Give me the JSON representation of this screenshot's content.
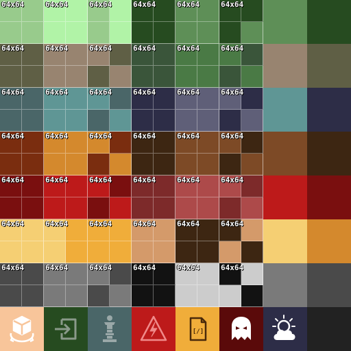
{
  "sheet": {
    "tile_label": "64x64",
    "rows": [
      [
        {
          "q": [
            "#98cb8c",
            "#98cb8c",
            "#98cb8c",
            "#98cb8c"
          ]
        },
        {
          "q": [
            "#b1f3a7",
            "#b1f3a7",
            "#b1f3a7",
            "#b1f3a7"
          ]
        },
        {
          "q": [
            "#98cb8c",
            "#b1f3a7",
            "#98cb8c",
            "#b1f3a7"
          ]
        },
        {
          "q": [
            "#264b20",
            "#264b20",
            "#264b20",
            "#264b20"
          ]
        },
        {
          "q": [
            "#5e8f57",
            "#5e8f57",
            "#5e8f57",
            "#5e8f57"
          ]
        },
        {
          "q": [
            "#264b20",
            "#264b20",
            "#264b20",
            "#5e8f57"
          ]
        },
        {
          "solid": "#5e8f57"
        },
        {
          "solid": "#264b20"
        }
      ],
      [
        {
          "q": [
            "#5f5f45",
            "#5f5f45",
            "#5f5f45",
            "#5f5f45"
          ]
        },
        {
          "q": [
            "#988470",
            "#988470",
            "#988470",
            "#988470"
          ]
        },
        {
          "q": [
            "#988470",
            "#5f5f45",
            "#5f5f45",
            "#988470"
          ]
        },
        {
          "q": [
            "#3a553a",
            "#3a553a",
            "#3a553a",
            "#3a553a"
          ]
        },
        {
          "q": [
            "#4a7a45",
            "#4a7a45",
            "#4a7a45",
            "#4a7a45"
          ]
        },
        {
          "q": [
            "#4a7a45",
            "#3a553a",
            "#3a553a",
            "#4a7a45"
          ]
        },
        {
          "solid": "#988470"
        },
        {
          "solid": "#5f5f45"
        }
      ],
      [
        {
          "q": [
            "#4a6668",
            "#4a6668",
            "#4a6668",
            "#4a6668"
          ]
        },
        {
          "q": [
            "#5f9695",
            "#5f9695",
            "#5f9695",
            "#5f9695"
          ]
        },
        {
          "q": [
            "#5f9695",
            "#4a6668",
            "#4a6668",
            "#5f9695"
          ]
        },
        {
          "q": [
            "#2d2d47",
            "#2d2d47",
            "#2d2d47",
            "#2d2d47"
          ]
        },
        {
          "q": [
            "#5f5f78",
            "#5f5f78",
            "#5f5f78",
            "#5f5f78"
          ]
        },
        {
          "q": [
            "#5f5f78",
            "#2d2d47",
            "#2d2d47",
            "#5f5f78"
          ]
        },
        {
          "solid": "#5f9695"
        },
        {
          "solid": "#2d2d47"
        }
      ],
      [
        {
          "q": [
            "#7a2d0f",
            "#7a2d0f",
            "#7a2d0f",
            "#7a2d0f"
          ]
        },
        {
          "q": [
            "#d4892d",
            "#d4892d",
            "#d4892d",
            "#d4892d"
          ]
        },
        {
          "q": [
            "#d4892d",
            "#7a2d0f",
            "#7a2d0f",
            "#d4892d"
          ]
        },
        {
          "q": [
            "#3d2612",
            "#3d2612",
            "#3d2612",
            "#3d2612"
          ]
        },
        {
          "q": [
            "#7d4a26",
            "#7d4a26",
            "#7d4a26",
            "#7d4a26"
          ]
        },
        {
          "q": [
            "#7d4a26",
            "#3d2612",
            "#3d2612",
            "#7d4a26"
          ]
        },
        {
          "solid": "#7d4a26"
        },
        {
          "solid": "#3d2612"
        }
      ],
      [
        {
          "q": [
            "#7a0f0f",
            "#7a0f0f",
            "#7a0f0f",
            "#7a0f0f"
          ]
        },
        {
          "q": [
            "#bd1a1a",
            "#bd1a1a",
            "#bd1a1a",
            "#bd1a1a"
          ]
        },
        {
          "q": [
            "#bd1a1a",
            "#7a0f0f",
            "#7a0f0f",
            "#bd1a1a"
          ]
        },
        {
          "q": [
            "#7d2a2a",
            "#7d2a2a",
            "#7d2a2a",
            "#7d2a2a"
          ]
        },
        {
          "q": [
            "#ad4a4a",
            "#ad4a4a",
            "#ad4a4a",
            "#ad4a4a"
          ]
        },
        {
          "q": [
            "#ad4a4a",
            "#7d2a2a",
            "#7d2a2a",
            "#ad4a4a"
          ]
        },
        {
          "solid": "#bd1a1a"
        },
        {
          "solid": "#7a0f0f"
        }
      ],
      [
        {
          "q": [
            "#f5cf73",
            "#f5cf73",
            "#f5cf73",
            "#f5cf73"
          ]
        },
        {
          "q": [
            "#f5cf73",
            "#f0ad3a",
            "#f5cf73",
            "#f0ad3a"
          ]
        },
        {
          "q": [
            "#f0ad3a",
            "#f0ad3a",
            "#f0ad3a",
            "#f0ad3a"
          ]
        },
        {
          "q": [
            "#d49a6a",
            "#d49a6a",
            "#d49a6a",
            "#d49a6a"
          ]
        },
        {
          "q": [
            "#3d2612",
            "#3d2612",
            "#3d2612",
            "#3d2612"
          ]
        },
        {
          "q": [
            "#3d2612",
            "#d49a6a",
            "#d49a6a",
            "#3d2612"
          ]
        },
        {
          "solid": "#f5cf73"
        },
        {
          "solid": "#d4892d"
        }
      ],
      [
        {
          "q": [
            "#4a4a4a",
            "#4a4a4a",
            "#4a4a4a",
            "#4a4a4a"
          ]
        },
        {
          "q": [
            "#7a7a7a",
            "#7a7a7a",
            "#7a7a7a",
            "#7a7a7a"
          ]
        },
        {
          "q": [
            "#7a7a7a",
            "#4a4a4a",
            "#4a4a4a",
            "#7a7a7a"
          ]
        },
        {
          "q": [
            "#121212",
            "#121212",
            "#121212",
            "#121212"
          ]
        },
        {
          "q": [
            "#cccccc",
            "#cccccc",
            "#cccccc",
            "#cccccc"
          ]
        },
        {
          "q": [
            "#121212",
            "#cccccc",
            "#cccccc",
            "#121212"
          ]
        },
        {
          "solid": "#7a7a7a"
        },
        {
          "solid": "#4a4a4a"
        }
      ]
    ],
    "icons": [
      {
        "name": "cube-rotate-icon",
        "bg": "#f8c59a"
      },
      {
        "name": "sign-in-icon",
        "bg": "#264b20"
      },
      {
        "name": "statue-icon",
        "bg": "#4a6668"
      },
      {
        "name": "high-voltage-icon",
        "bg": "#bd1a1a"
      },
      {
        "name": "code-file-icon",
        "bg": "#f0ad3a"
      },
      {
        "name": "ghost-icon",
        "bg": "#5a0a0a"
      },
      {
        "name": "partly-cloudy-icon",
        "bg": "#2d2d47"
      },
      {
        "name": "empty-tile",
        "bg": "#222222"
      }
    ]
  }
}
